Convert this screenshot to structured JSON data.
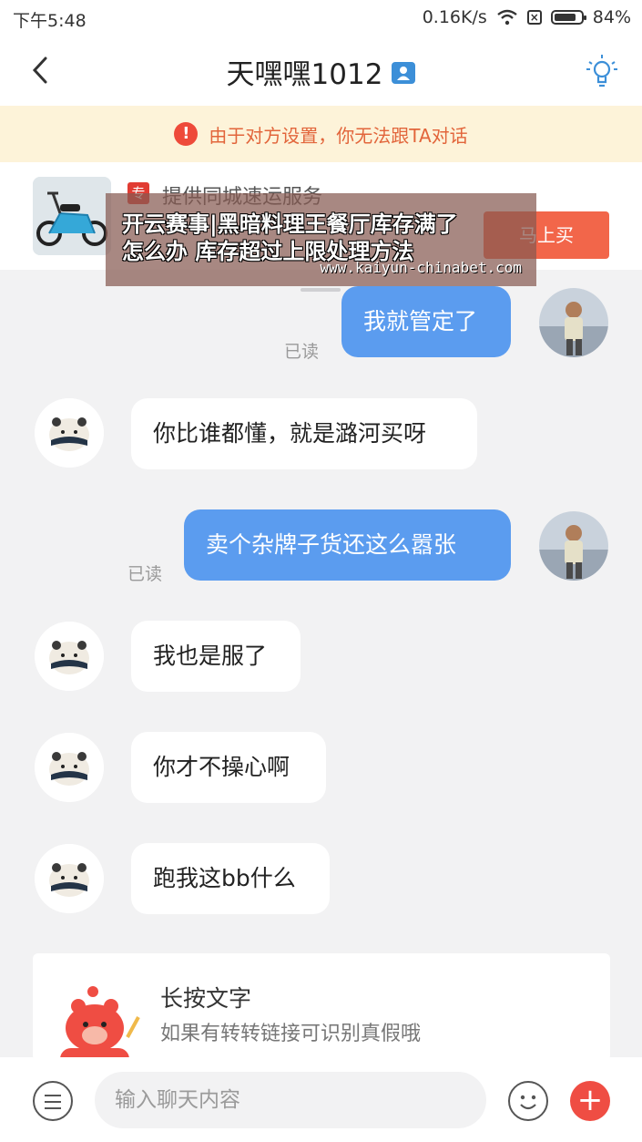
{
  "status_bar": {
    "time": "下午5:48",
    "network_speed": "0.16K/s",
    "battery_level": 84,
    "battery_text": "84%"
  },
  "header": {
    "title": "天嘿嘿1012",
    "back_icon": "back-chevron-icon",
    "id_icon": "profile-card-icon",
    "tip_icon": "lightbulb-icon"
  },
  "notice": {
    "text": "由于对方设置，你无法跟TA对话",
    "icon": "warning-icon"
  },
  "product": {
    "tag": "专",
    "title": "提供同城速运服务",
    "buy_label": "马上买"
  },
  "overlay": {
    "line1": "开云赛事|黑暗料理王餐厅库存满了",
    "line2": "怎么办 库存超过上限处理方法",
    "site": "www.kaiyun-chinabet.com"
  },
  "messages": [
    {
      "side": "right",
      "text": "我就管定了",
      "read": "已读"
    },
    {
      "side": "left",
      "text": "你比谁都懂，就是潞河买呀"
    },
    {
      "side": "right",
      "text": "卖个杂牌子货还这么嚣张",
      "read": "已读"
    },
    {
      "side": "left",
      "text": "我也是服了"
    },
    {
      "side": "left",
      "text": "你才不操心啊"
    },
    {
      "side": "left",
      "text": "跑我这bb什么"
    }
  ],
  "tip_card": {
    "title": "长按文字",
    "subtitle": "如果有转转链接可识别真假哦"
  },
  "input_bar": {
    "placeholder": "输入聊天内容",
    "menu_icon": "menu-icon",
    "emoji_icon": "emoji-icon",
    "plus_icon": "plus-icon"
  },
  "colors": {
    "outgoing_bubble": "#5b9cef",
    "incoming_bubble": "#ffffff",
    "notice_text": "#e2653b",
    "accent": "#ef4d43"
  }
}
